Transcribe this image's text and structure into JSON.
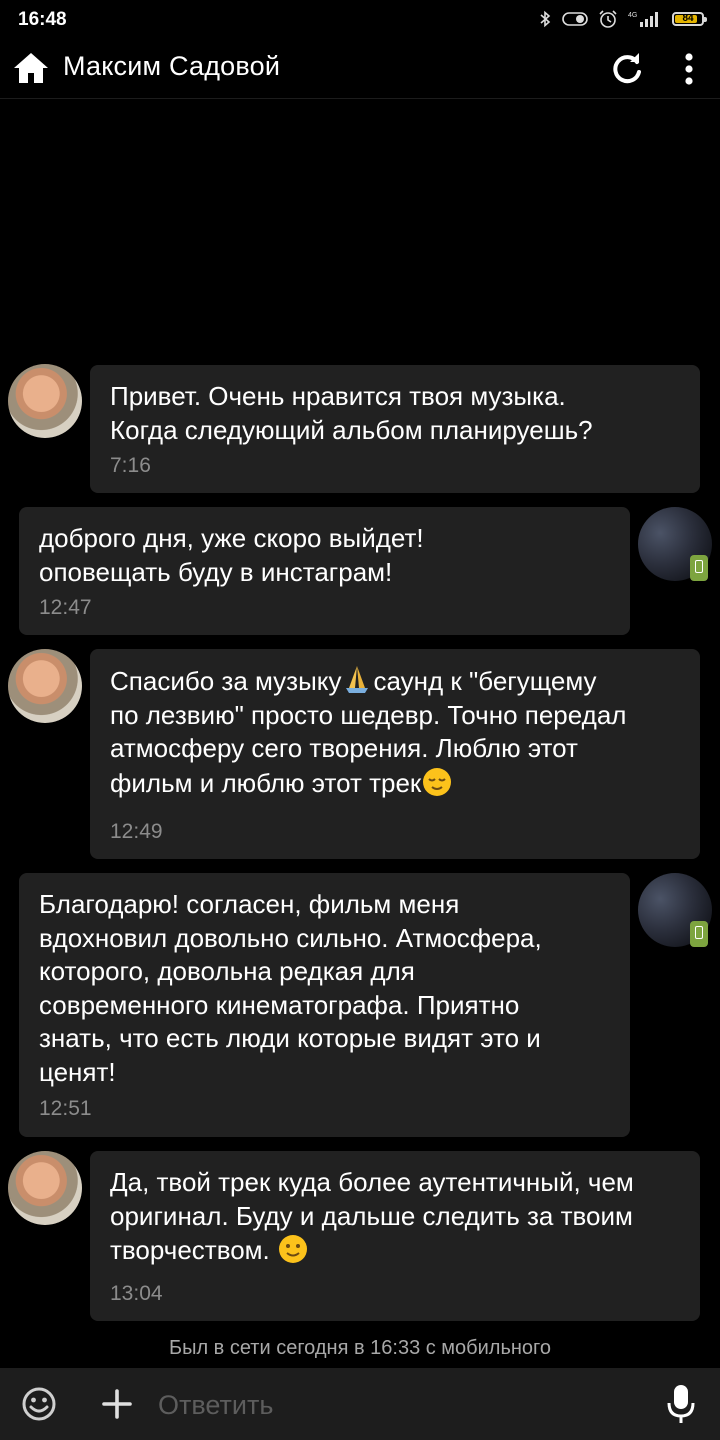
{
  "status_bar": {
    "time": "16:48",
    "battery_level": 84,
    "battery_label": "84",
    "network": "4G",
    "accent_battery": "#e3b400",
    "icons": [
      "bluetooth-icon",
      "data-saver-icon",
      "alarm-icon",
      "signal-icon",
      "battery-icon"
    ]
  },
  "app_bar": {
    "title": "Максим Садовой",
    "icons": [
      "home-icon",
      "refresh-icon",
      "more-vert-icon"
    ]
  },
  "messages": [
    {
      "direction": "incoming",
      "text": "Привет. Очень нравится твоя музыка.\nКогда следующий альбом планируешь?",
      "time": "7:16"
    },
    {
      "direction": "outgoing",
      "text": "доброго дня, уже скоро выйдет!\nоповещать буду в инстаграм!",
      "time": "12:47"
    },
    {
      "direction": "incoming",
      "text_parts": [
        "Спасибо за музыку",
        "саунд к \"бегущему\nпо лезвию\" просто шедевр. Точно передал\nатмосферу сего творения. Люблю этот\nфильм и люблю этот трек"
      ],
      "emojis": [
        "folded-hands-emoji",
        "relieved-face-emoji"
      ],
      "time": "12:49"
    },
    {
      "direction": "outgoing",
      "text": "Благодарю!  согласен, фильм меня\nвдохновил довольно сильно. Атмосфера,\nкоторого, довольна редкая для\nсовременного кинематографа. Приятно\nзнать, что есть люди которые видят это и\nценят!",
      "time": "12:51"
    },
    {
      "direction": "incoming",
      "text": "Да, твой трек куда более аутентичный, чем\nоригинал. Буду и дальше следить за твоим\nтворчеством. ",
      "emojis": [
        "slightly-smiling-face-emoji"
      ],
      "time": "13:04"
    }
  ],
  "last_seen": "Был в сети сегодня в 16:33 с мобильного",
  "input_bar": {
    "placeholder": "Ответить",
    "icons": [
      "emoji-icon",
      "plus-icon",
      "mic-icon"
    ]
  },
  "colors": {
    "background": "#000000",
    "bubble": "#212121",
    "time_text": "#8c8c8c",
    "mobile_badge": "#7da43f",
    "input_bar": "#1d1d1d"
  }
}
